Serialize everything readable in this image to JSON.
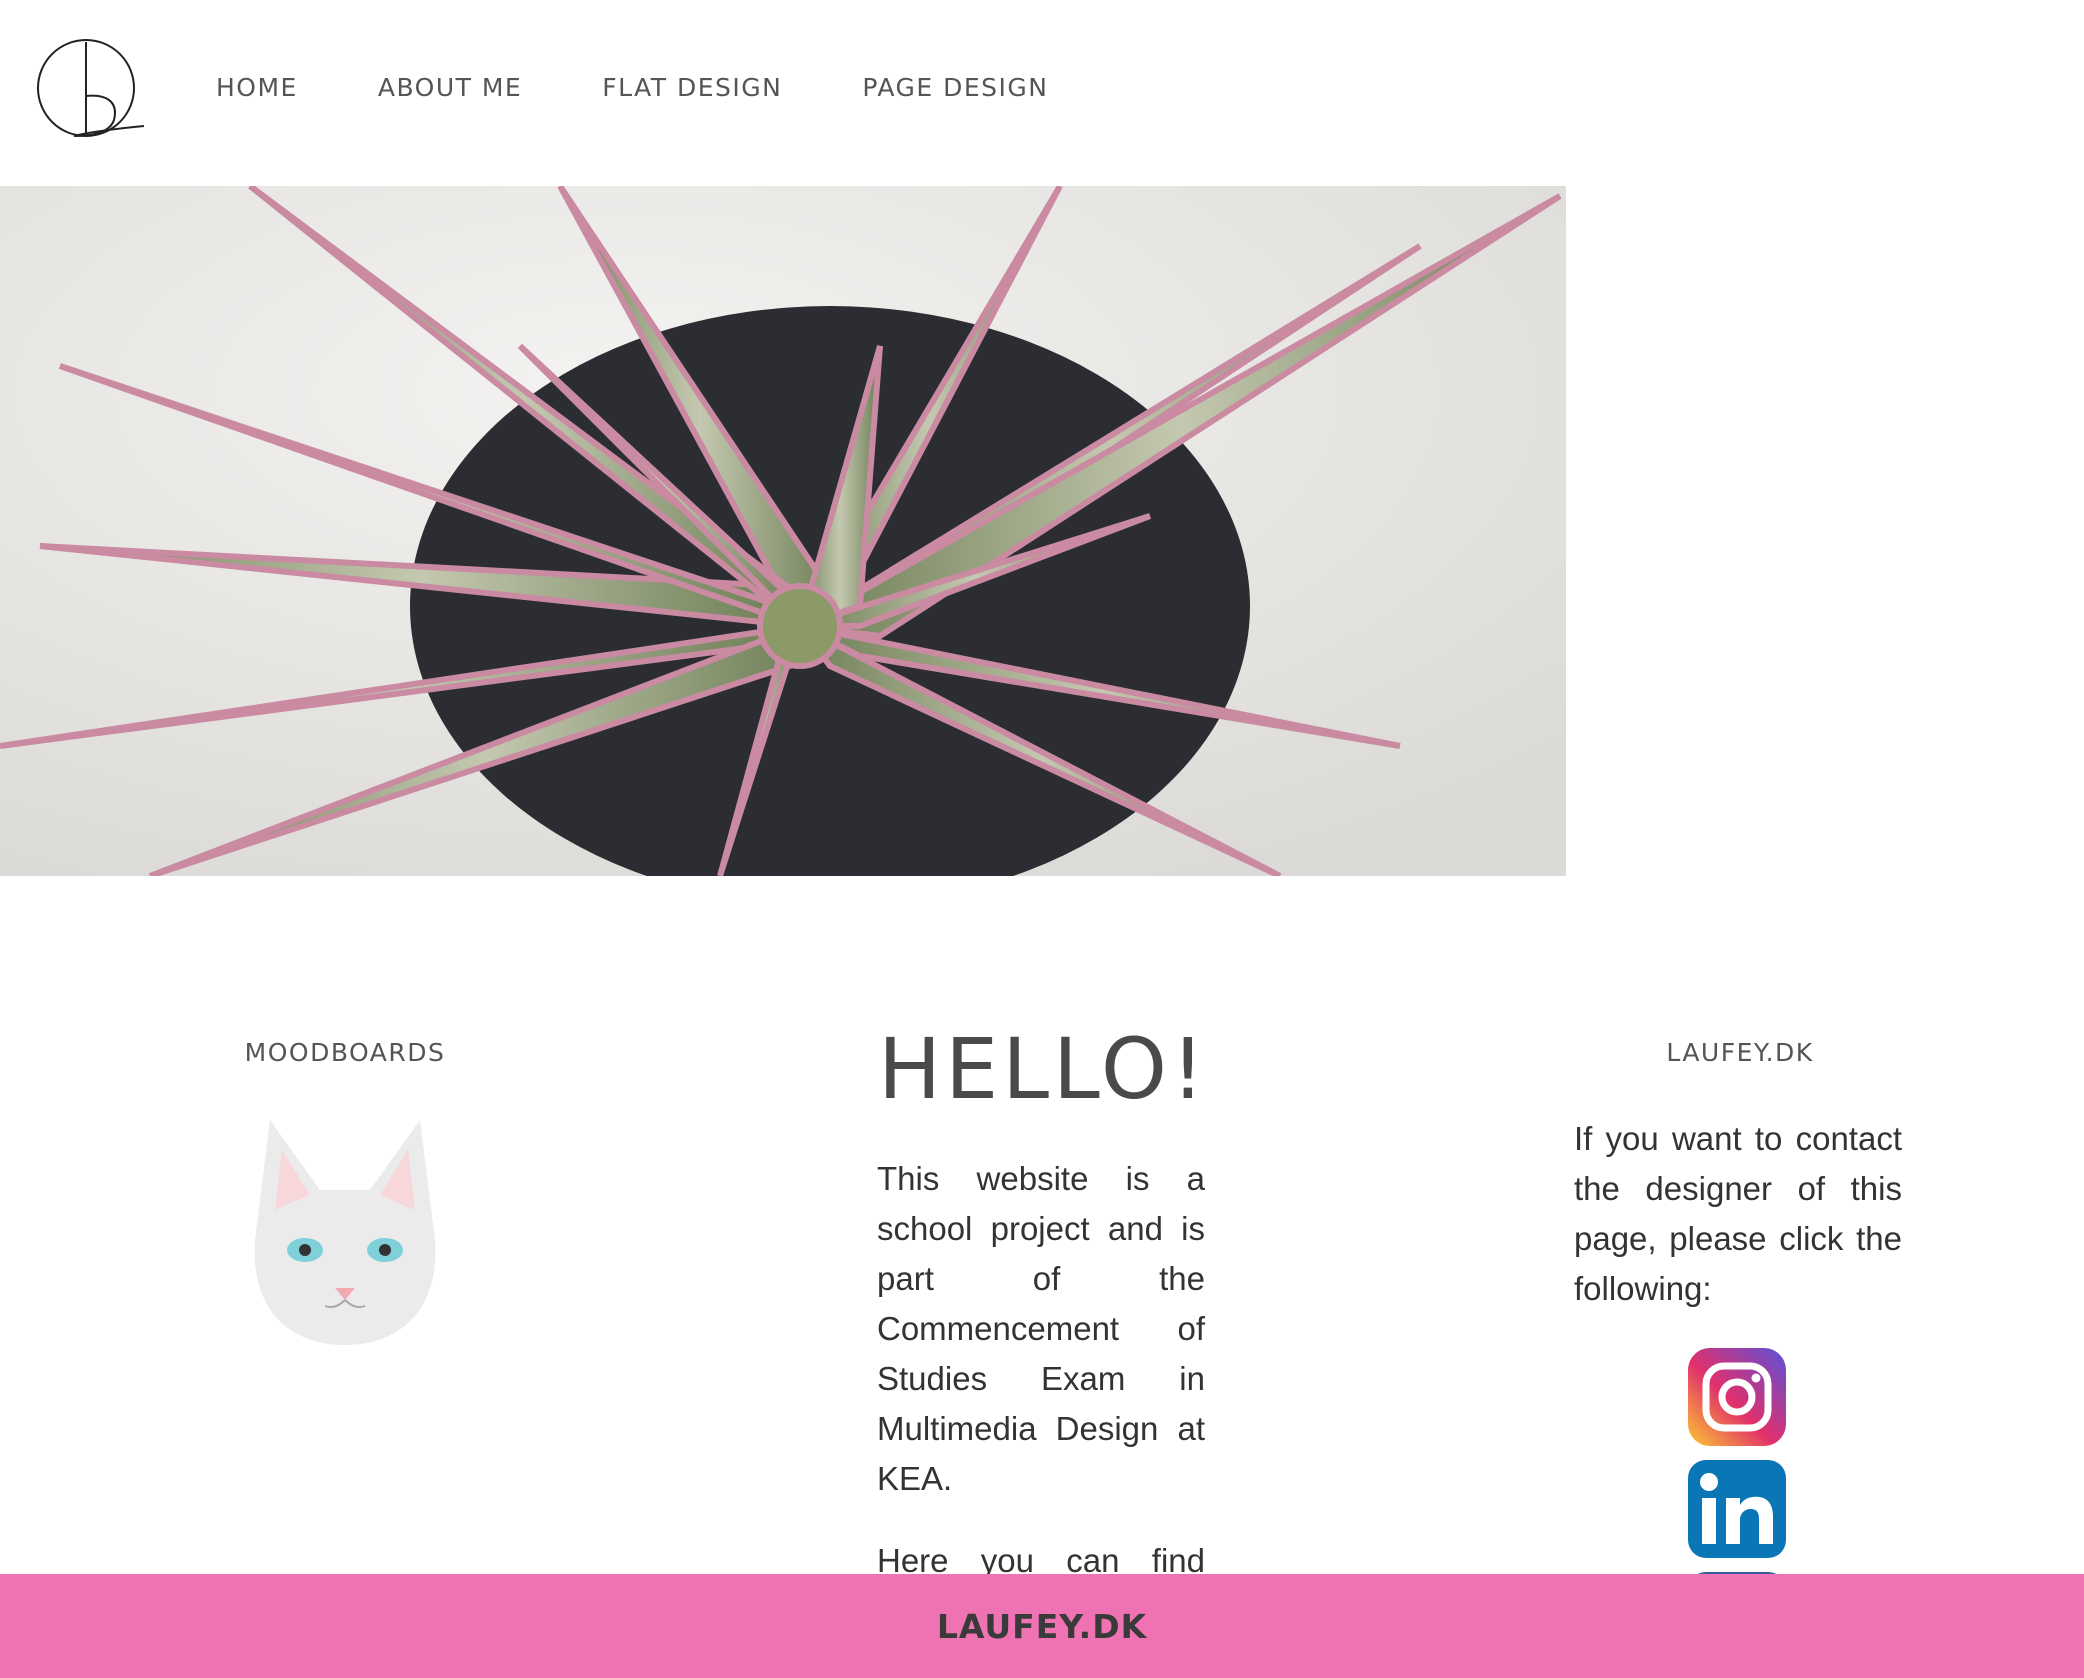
{
  "nav": {
    "items": [
      "HOME",
      "ABOUT ME",
      "FLAT DESIGN",
      "PAGE DESIGN"
    ]
  },
  "left_column": {
    "title": "MOODBOARDS"
  },
  "center_column": {
    "heading": "HELLO!",
    "paragraph1": "This website is a school project and is part of the Commencement of Studies Exam in Multimedia Design at KEA.",
    "paragraph2": "Here you can find"
  },
  "right_column": {
    "title": "LAUFEY.DK",
    "text": "If you want to contact the designer of this page, please click the following:",
    "social_icons": [
      "instagram-icon",
      "linkedin-icon",
      "facebook-icon"
    ]
  },
  "footer": {
    "text": "LAUFEY.DK"
  },
  "colors": {
    "footer_bg": "#ef72b2",
    "linkedin": "#0a76b5",
    "text": "#444444"
  }
}
